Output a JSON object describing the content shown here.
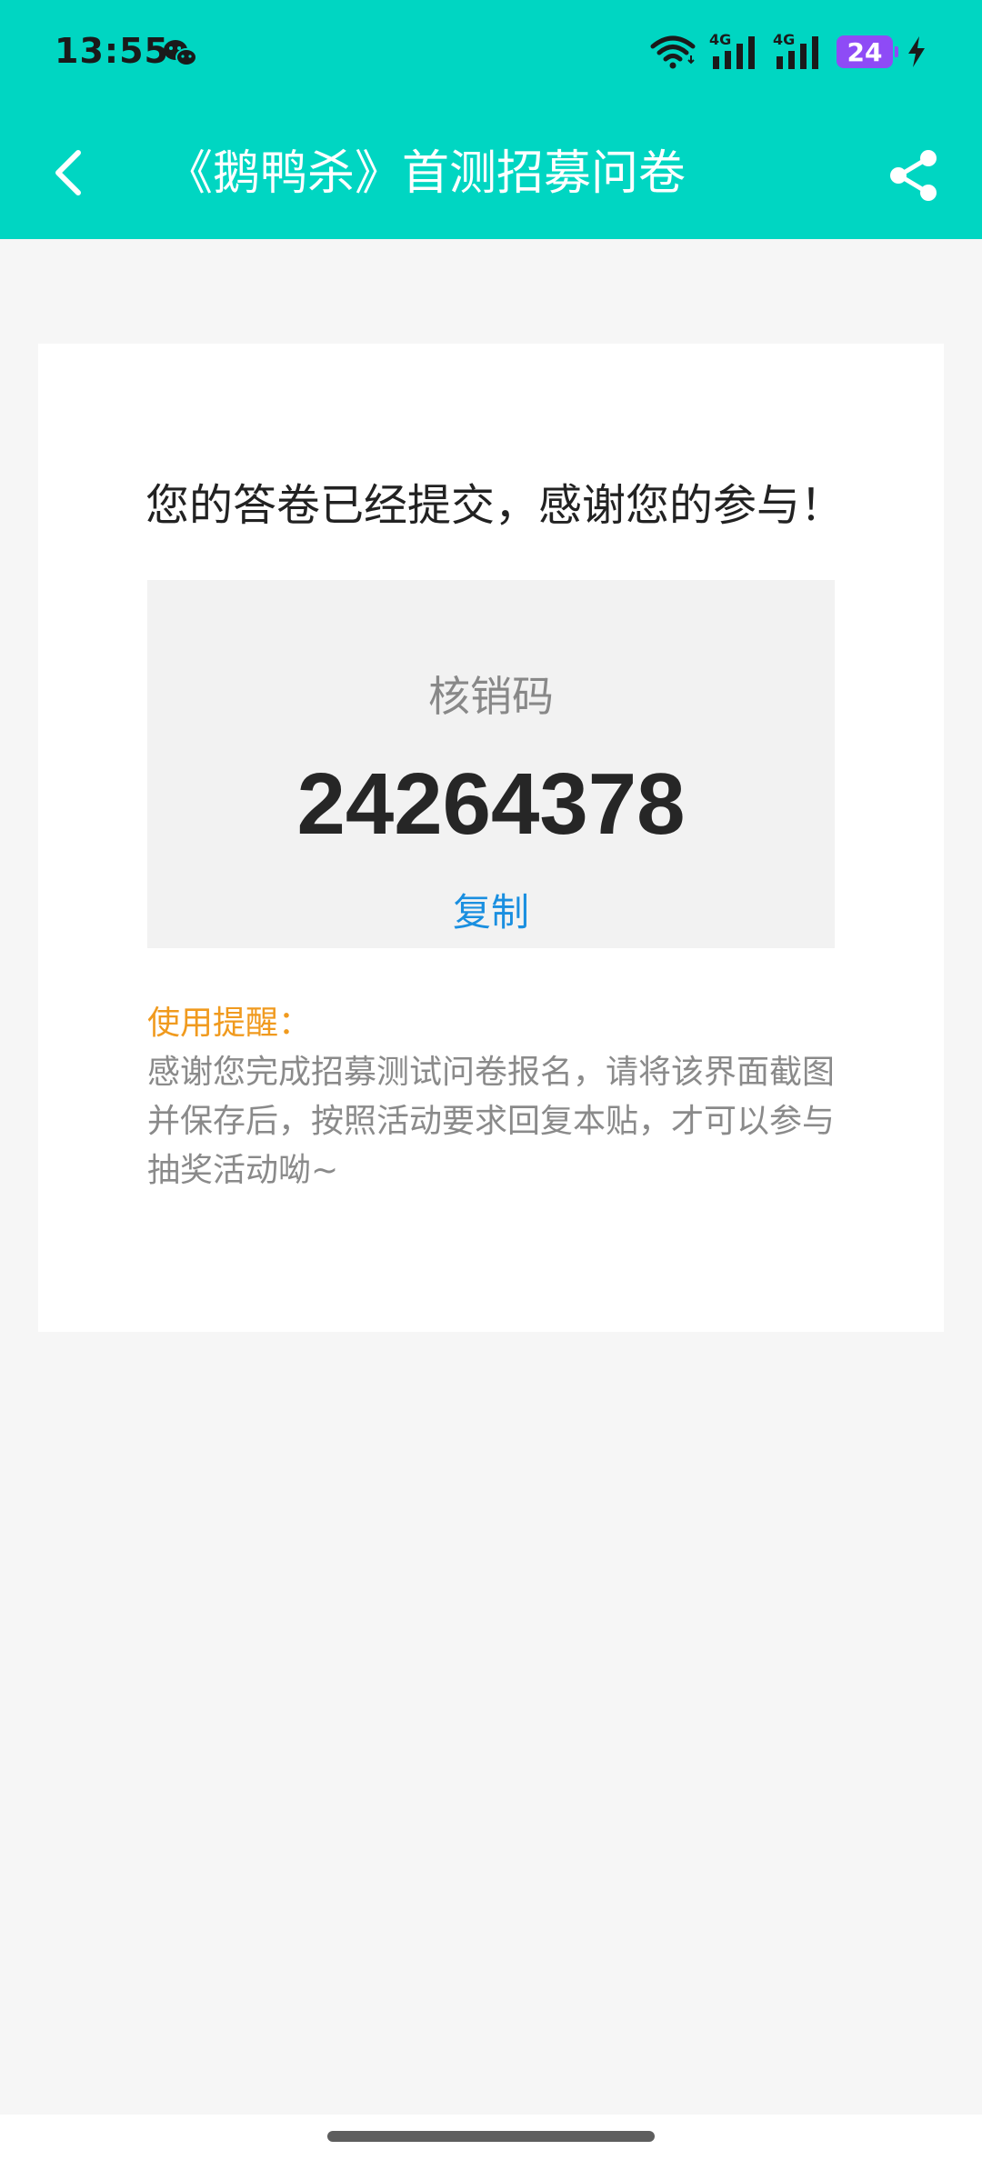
{
  "status_bar": {
    "time": "13:55",
    "wechat_icon": "wechat-icon",
    "signal_1_label": "4G",
    "signal_2_label": "4G",
    "battery_level": "24",
    "charging_icon": "lightning-icon"
  },
  "app_bar": {
    "title": "《鹅鸭杀》首测招募问卷",
    "back_icon": "chevron-left-icon",
    "share_icon": "share-icon"
  },
  "main": {
    "success_message": "您的答卷已经提交，感谢您的参与！",
    "code_label": "核销码",
    "code_value": "24264378",
    "copy_label": "复制",
    "reminder_title": "使用提醒：",
    "reminder_body": "感谢您完成招募测试问卷报名，请将该界面截图并保存后，按照活动要求回复本贴，才可以参与抽奖活动呦~"
  },
  "colors": {
    "header": "#00d6c2",
    "accent_link": "#1a8fe0",
    "reminder": "#f09a1e",
    "battery": "#8e4bf6"
  }
}
